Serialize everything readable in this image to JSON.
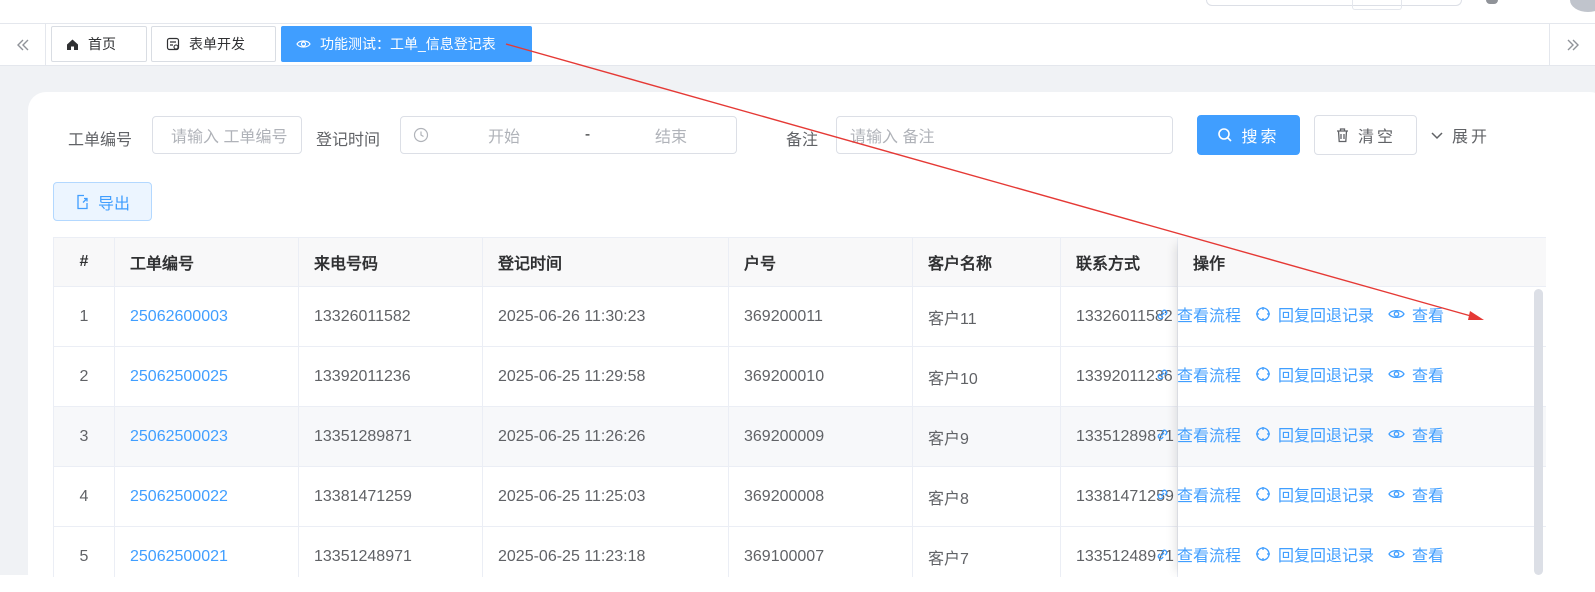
{
  "tabs": [
    {
      "label": "首页",
      "icon": "home-icon"
    },
    {
      "label": "表单开发",
      "icon": "form-icon"
    },
    {
      "label": "功能测试：工单_信息登记表",
      "icon": "eye-icon",
      "active": true
    }
  ],
  "search": {
    "order_no_label": "工单编号",
    "order_no_placeholder": "请输入 工单编号",
    "time_label": "登记时间",
    "time_start_placeholder": "开始",
    "time_separator": "-",
    "time_end_placeholder": "结束",
    "remark_label": "备注",
    "remark_placeholder": "请输入 备注",
    "search_button": "搜索",
    "clear_button": "清空",
    "expand_button": "展开"
  },
  "toolbar": {
    "export_button": "导出"
  },
  "table": {
    "columns": [
      "#",
      "工单编号",
      "来电号码",
      "登记时间",
      "户号",
      "客户名称",
      "联系方式",
      "操作"
    ],
    "rows": [
      {
        "index": "1",
        "order_no": "25062600003",
        "phone": "13326011582",
        "time": "2025-06-26 11:30:23",
        "account": "369200011",
        "customer": "客户11",
        "contact": "13326011582"
      },
      {
        "index": "2",
        "order_no": "25062500025",
        "phone": "13392011236",
        "time": "2025-06-25 11:29:58",
        "account": "369200010",
        "customer": "客户10",
        "contact": "13392011236"
      },
      {
        "index": "3",
        "order_no": "25062500023",
        "phone": "13351289871",
        "time": "2025-06-25 11:26:26",
        "account": "369200009",
        "customer": "客户9",
        "contact": "13351289871"
      },
      {
        "index": "4",
        "order_no": "25062500022",
        "phone": "13381471259",
        "time": "2025-06-25 11:25:03",
        "account": "369200008",
        "customer": "客户8",
        "contact": "13381471259"
      },
      {
        "index": "5",
        "order_no": "25062500021",
        "phone": "13351248971",
        "time": "2025-06-25 11:23:18",
        "account": "369100007",
        "customer": "客户7",
        "contact": "13351248971"
      }
    ],
    "actions": [
      {
        "label": "查看流程",
        "icon": "link-icon"
      },
      {
        "label": "回复回退记录",
        "icon": "target-icon"
      },
      {
        "label": "查看",
        "icon": "eye-icon"
      }
    ]
  },
  "colors": {
    "primary": "#409eff",
    "annotation": "#e53935"
  }
}
